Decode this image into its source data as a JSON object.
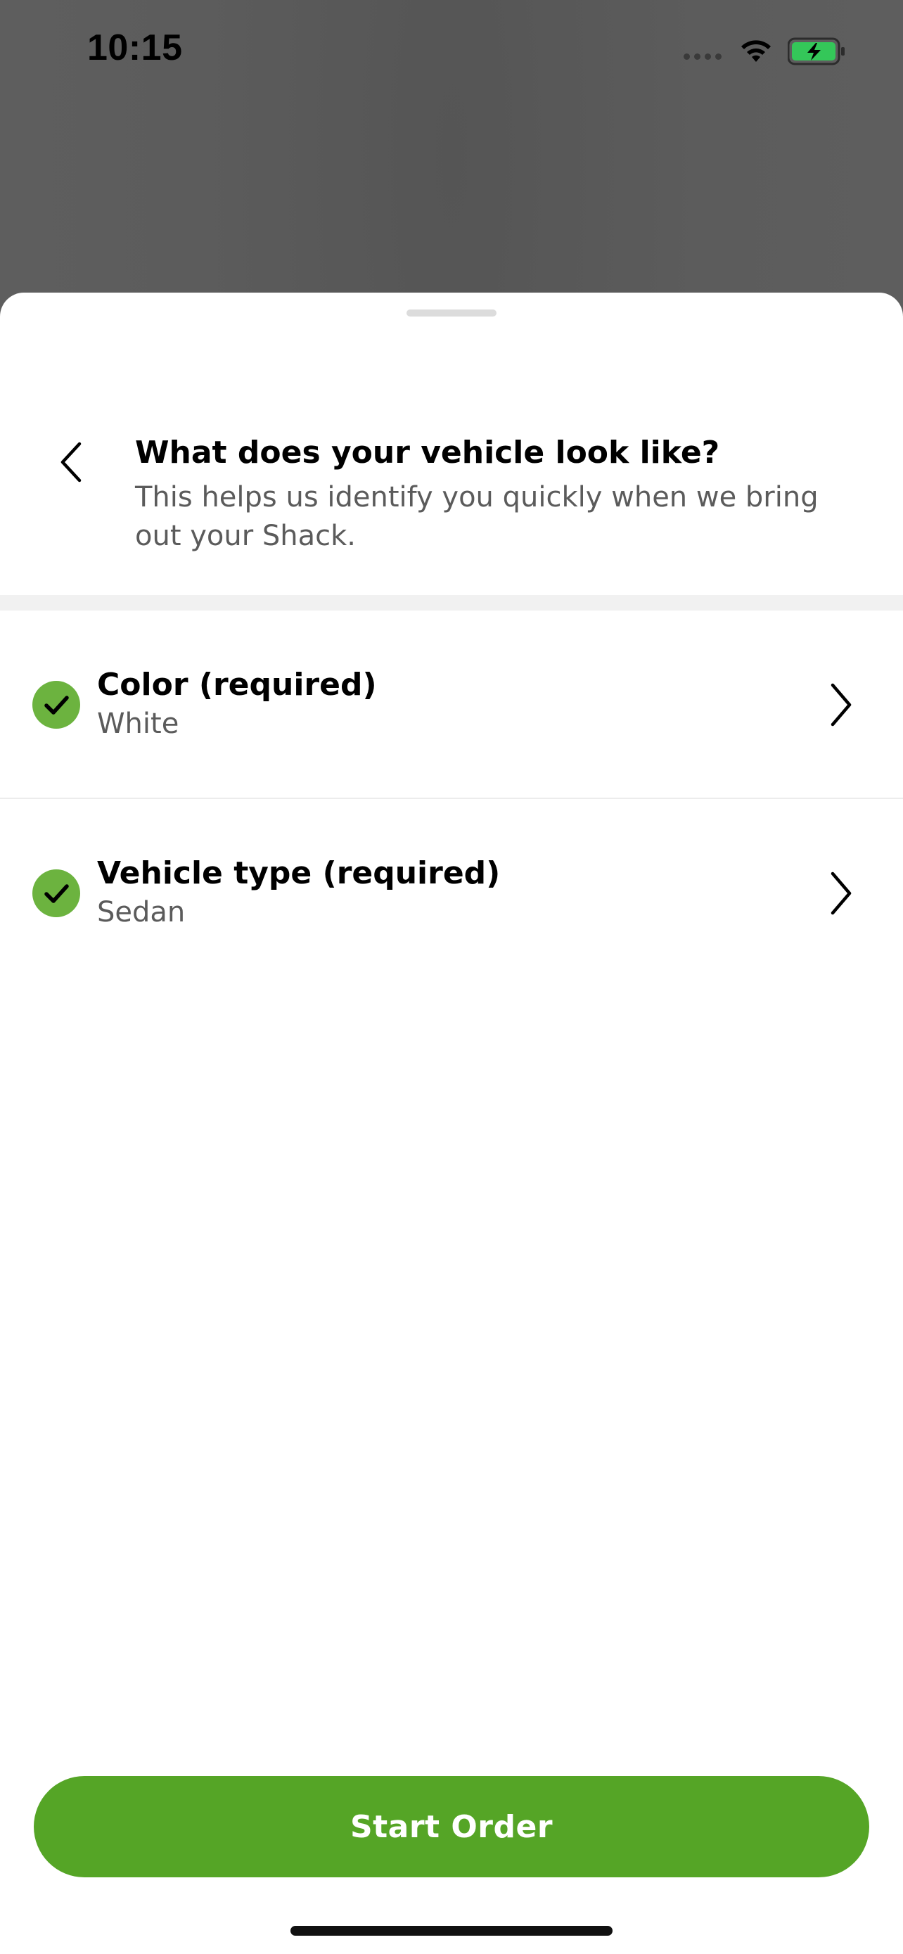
{
  "status_bar": {
    "time": "10:15",
    "battery_color": "#34c759"
  },
  "sheet": {
    "header": {
      "title": "What does your vehicle look like?",
      "subtitle": "This helps us identify you quickly when we bring out your Shack.",
      "back_icon": "chevron-left-icon"
    },
    "options": [
      {
        "label": "Color (required)",
        "value": "White",
        "completed": true,
        "status_icon": "check-circle-icon"
      },
      {
        "label": "Vehicle type (required)",
        "value": "Sedan",
        "completed": true,
        "status_icon": "check-circle-icon"
      }
    ],
    "primary_button": {
      "label": "Start Order",
      "color": "#55a526"
    }
  },
  "theme": {
    "accent": "#55a526",
    "check_fill": "#6cb33f"
  }
}
